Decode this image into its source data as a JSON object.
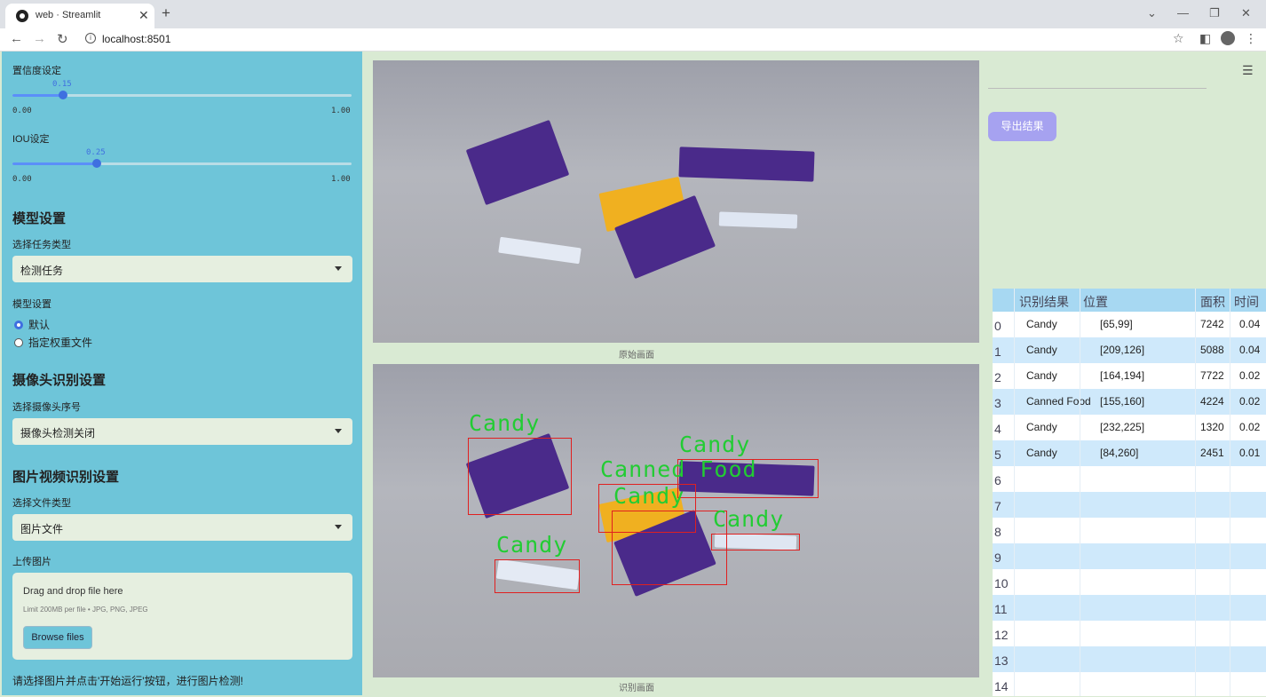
{
  "browser": {
    "tab_title": "web · Streamlit",
    "url": "localhost:8501"
  },
  "sidebar": {
    "conf": {
      "label": "置信度设定",
      "value": "0.15",
      "value_num": 0.15,
      "min": "0.00",
      "max": "1.00"
    },
    "iou": {
      "label": "IOU设定",
      "value": "0.25",
      "value_num": 0.25,
      "min": "0.00",
      "max": "1.00"
    },
    "model_section": "模型设置",
    "task_label": "选择任务类型",
    "task_value": "检测任务",
    "model_label": "模型设置",
    "model_options": [
      "默认",
      "指定权重文件"
    ],
    "camera_section": "摄像头识别设置",
    "camera_label": "选择摄像头序号",
    "camera_value": "摄像头检测关闭",
    "media_section": "图片视频识别设置",
    "filetype_label": "选择文件类型",
    "filetype_value": "图片文件",
    "upload_label": "上传图片",
    "upload_title": "Drag and drop file here",
    "upload_limit": "Limit 200MB per file • JPG, PNG, JPEG",
    "browse_label": "Browse files",
    "hint": "请选择图片并点击'开始运行'按钮，进行图片检测!"
  },
  "main": {
    "original_caption": "原始画面",
    "result_caption": "识别画面",
    "detections": [
      {
        "label": "Candy"
      },
      {
        "label": "Candy"
      },
      {
        "label": "Canned Food"
      },
      {
        "label": "Candy"
      },
      {
        "label": "Candy"
      },
      {
        "label": "Candy"
      }
    ]
  },
  "right": {
    "export_label": "导出结果",
    "table": {
      "headers": [
        "识别结果",
        "位置",
        "面积",
        "时间"
      ],
      "rows": [
        {
          "idx": "0",
          "result": "Candy",
          "pos": "[65,99]",
          "area": "7242",
          "time": "0.04"
        },
        {
          "idx": "1",
          "result": "Candy",
          "pos": "[209,126]",
          "area": "5088",
          "time": "0.04"
        },
        {
          "idx": "2",
          "result": "Candy",
          "pos": "[164,194]",
          "area": "7722",
          "time": "0.02"
        },
        {
          "idx": "3",
          "result": "Canned Food",
          "pos": "[155,160]",
          "area": "4224",
          "time": "0.02"
        },
        {
          "idx": "4",
          "result": "Candy",
          "pos": "[232,225]",
          "area": "1320",
          "time": "0.02"
        },
        {
          "idx": "5",
          "result": "Candy",
          "pos": "[84,260]",
          "area": "2451",
          "time": "0.01"
        },
        {
          "idx": "6",
          "result": "",
          "pos": "",
          "area": "",
          "time": ""
        },
        {
          "idx": "7",
          "result": "",
          "pos": "",
          "area": "",
          "time": ""
        },
        {
          "idx": "8",
          "result": "",
          "pos": "",
          "area": "",
          "time": ""
        },
        {
          "idx": "9",
          "result": "",
          "pos": "",
          "area": "",
          "time": ""
        },
        {
          "idx": "10",
          "result": "",
          "pos": "",
          "area": "",
          "time": ""
        },
        {
          "idx": "11",
          "result": "",
          "pos": "",
          "area": "",
          "time": ""
        },
        {
          "idx": "12",
          "result": "",
          "pos": "",
          "area": "",
          "time": ""
        },
        {
          "idx": "13",
          "result": "",
          "pos": "",
          "area": "",
          "time": ""
        },
        {
          "idx": "14",
          "result": "",
          "pos": "",
          "area": "",
          "time": ""
        }
      ]
    }
  },
  "colors": {
    "sidebar": "#6ec5d9",
    "main_bg": "#d9ead3",
    "accent": "#3f6fe0",
    "box": "#e02020",
    "label_green": "#22cc33",
    "export": "#a6a2f0"
  }
}
